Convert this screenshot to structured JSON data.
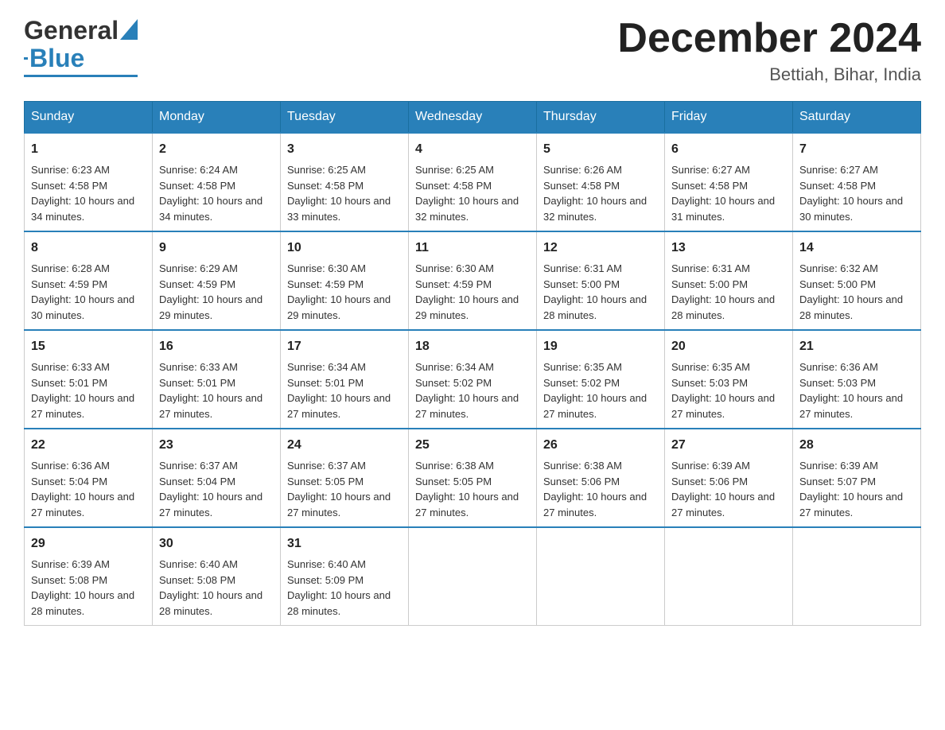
{
  "header": {
    "logo_main": "General",
    "logo_accent": "Blue",
    "month_title": "December 2024",
    "location": "Bettiah, Bihar, India"
  },
  "days_of_week": [
    "Sunday",
    "Monday",
    "Tuesday",
    "Wednesday",
    "Thursday",
    "Friday",
    "Saturday"
  ],
  "weeks": [
    [
      {
        "day": "1",
        "sunrise": "6:23 AM",
        "sunset": "4:58 PM",
        "daylight": "10 hours and 34 minutes."
      },
      {
        "day": "2",
        "sunrise": "6:24 AM",
        "sunset": "4:58 PM",
        "daylight": "10 hours and 34 minutes."
      },
      {
        "day": "3",
        "sunrise": "6:25 AM",
        "sunset": "4:58 PM",
        "daylight": "10 hours and 33 minutes."
      },
      {
        "day": "4",
        "sunrise": "6:25 AM",
        "sunset": "4:58 PM",
        "daylight": "10 hours and 32 minutes."
      },
      {
        "day": "5",
        "sunrise": "6:26 AM",
        "sunset": "4:58 PM",
        "daylight": "10 hours and 32 minutes."
      },
      {
        "day": "6",
        "sunrise": "6:27 AM",
        "sunset": "4:58 PM",
        "daylight": "10 hours and 31 minutes."
      },
      {
        "day": "7",
        "sunrise": "6:27 AM",
        "sunset": "4:58 PM",
        "daylight": "10 hours and 30 minutes."
      }
    ],
    [
      {
        "day": "8",
        "sunrise": "6:28 AM",
        "sunset": "4:59 PM",
        "daylight": "10 hours and 30 minutes."
      },
      {
        "day": "9",
        "sunrise": "6:29 AM",
        "sunset": "4:59 PM",
        "daylight": "10 hours and 29 minutes."
      },
      {
        "day": "10",
        "sunrise": "6:30 AM",
        "sunset": "4:59 PM",
        "daylight": "10 hours and 29 minutes."
      },
      {
        "day": "11",
        "sunrise": "6:30 AM",
        "sunset": "4:59 PM",
        "daylight": "10 hours and 29 minutes."
      },
      {
        "day": "12",
        "sunrise": "6:31 AM",
        "sunset": "5:00 PM",
        "daylight": "10 hours and 28 minutes."
      },
      {
        "day": "13",
        "sunrise": "6:31 AM",
        "sunset": "5:00 PM",
        "daylight": "10 hours and 28 minutes."
      },
      {
        "day": "14",
        "sunrise": "6:32 AM",
        "sunset": "5:00 PM",
        "daylight": "10 hours and 28 minutes."
      }
    ],
    [
      {
        "day": "15",
        "sunrise": "6:33 AM",
        "sunset": "5:01 PM",
        "daylight": "10 hours and 27 minutes."
      },
      {
        "day": "16",
        "sunrise": "6:33 AM",
        "sunset": "5:01 PM",
        "daylight": "10 hours and 27 minutes."
      },
      {
        "day": "17",
        "sunrise": "6:34 AM",
        "sunset": "5:01 PM",
        "daylight": "10 hours and 27 minutes."
      },
      {
        "day": "18",
        "sunrise": "6:34 AM",
        "sunset": "5:02 PM",
        "daylight": "10 hours and 27 minutes."
      },
      {
        "day": "19",
        "sunrise": "6:35 AM",
        "sunset": "5:02 PM",
        "daylight": "10 hours and 27 minutes."
      },
      {
        "day": "20",
        "sunrise": "6:35 AM",
        "sunset": "5:03 PM",
        "daylight": "10 hours and 27 minutes."
      },
      {
        "day": "21",
        "sunrise": "6:36 AM",
        "sunset": "5:03 PM",
        "daylight": "10 hours and 27 minutes."
      }
    ],
    [
      {
        "day": "22",
        "sunrise": "6:36 AM",
        "sunset": "5:04 PM",
        "daylight": "10 hours and 27 minutes."
      },
      {
        "day": "23",
        "sunrise": "6:37 AM",
        "sunset": "5:04 PM",
        "daylight": "10 hours and 27 minutes."
      },
      {
        "day": "24",
        "sunrise": "6:37 AM",
        "sunset": "5:05 PM",
        "daylight": "10 hours and 27 minutes."
      },
      {
        "day": "25",
        "sunrise": "6:38 AM",
        "sunset": "5:05 PM",
        "daylight": "10 hours and 27 minutes."
      },
      {
        "day": "26",
        "sunrise": "6:38 AM",
        "sunset": "5:06 PM",
        "daylight": "10 hours and 27 minutes."
      },
      {
        "day": "27",
        "sunrise": "6:39 AM",
        "sunset": "5:06 PM",
        "daylight": "10 hours and 27 minutes."
      },
      {
        "day": "28",
        "sunrise": "6:39 AM",
        "sunset": "5:07 PM",
        "daylight": "10 hours and 27 minutes."
      }
    ],
    [
      {
        "day": "29",
        "sunrise": "6:39 AM",
        "sunset": "5:08 PM",
        "daylight": "10 hours and 28 minutes."
      },
      {
        "day": "30",
        "sunrise": "6:40 AM",
        "sunset": "5:08 PM",
        "daylight": "10 hours and 28 minutes."
      },
      {
        "day": "31",
        "sunrise": "6:40 AM",
        "sunset": "5:09 PM",
        "daylight": "10 hours and 28 minutes."
      },
      null,
      null,
      null,
      null
    ]
  ],
  "labels": {
    "sunrise": "Sunrise:",
    "sunset": "Sunset:",
    "daylight": "Daylight:"
  }
}
